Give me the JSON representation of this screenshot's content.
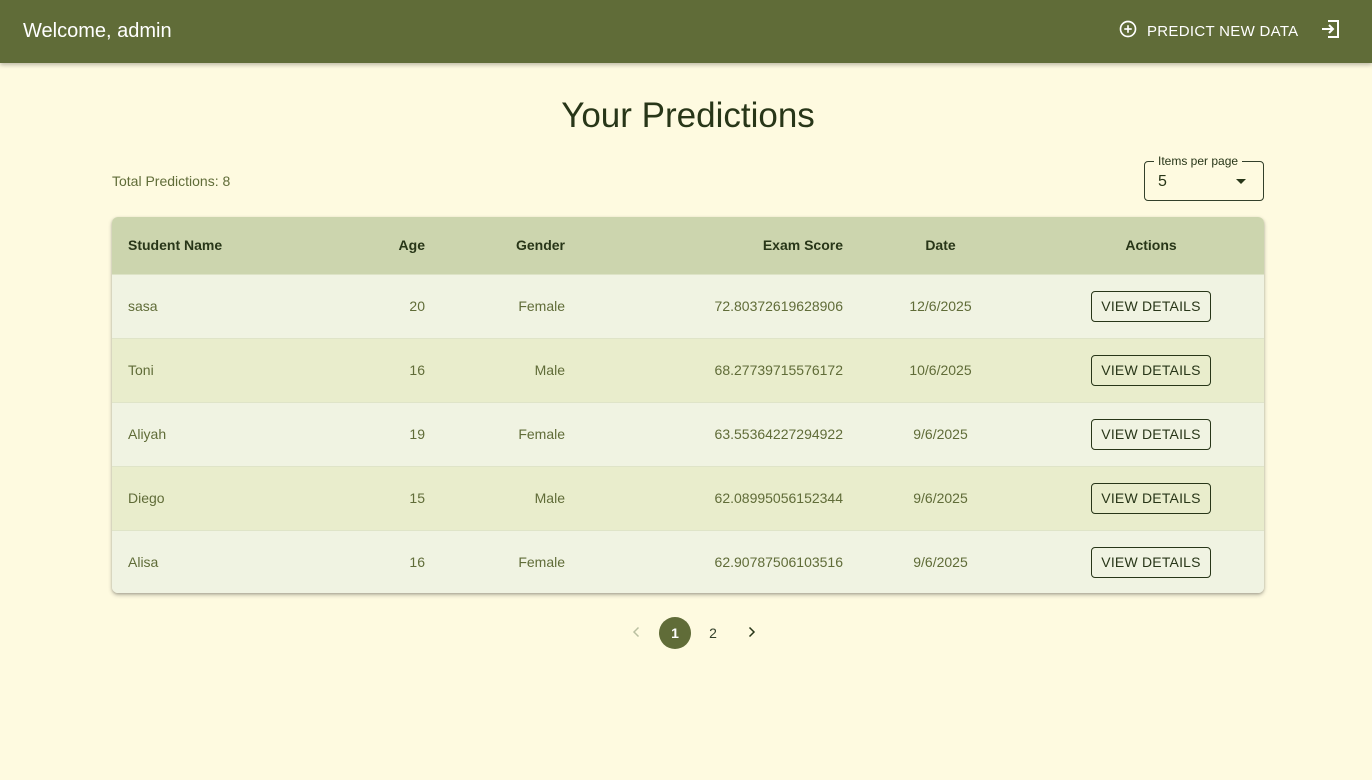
{
  "header": {
    "welcome": "Welcome, admin",
    "predict_label": "PREDICT NEW DATA",
    "predict_icon": "add-circle-icon",
    "logout_icon": "logout-icon"
  },
  "main": {
    "title": "Your Predictions",
    "total": "Total Predictions: 8",
    "items_per_page": {
      "label": "Items per page",
      "value": "5"
    }
  },
  "table": {
    "columns": [
      "Student Name",
      "Age",
      "Gender",
      "Exam Score",
      "Date",
      "Actions"
    ],
    "rows": [
      {
        "name": "sasa",
        "age": "20",
        "gender": "Female",
        "score": "72.80372619628906",
        "date": "12/6/2025",
        "action": "VIEW DETAILS"
      },
      {
        "name": "Toni",
        "age": "16",
        "gender": "Male",
        "score": "68.27739715576172",
        "date": "10/6/2025",
        "action": "VIEW DETAILS"
      },
      {
        "name": "Aliyah",
        "age": "19",
        "gender": "Female",
        "score": "63.55364227294922",
        "date": "9/6/2025",
        "action": "VIEW DETAILS"
      },
      {
        "name": "Diego",
        "age": "15",
        "gender": "Male",
        "score": "62.08995056152344",
        "date": "9/6/2025",
        "action": "VIEW DETAILS"
      },
      {
        "name": "Alisa",
        "age": "16",
        "gender": "Female",
        "score": "62.90787506103516",
        "date": "9/6/2025",
        "action": "VIEW DETAILS"
      }
    ]
  },
  "pagination": {
    "pages": [
      "1",
      "2"
    ],
    "current": "1"
  },
  "colors": {
    "appbar": "#606c38",
    "background": "#fefae0",
    "table_header": "#ccd5ae",
    "text_dark": "#283618"
  }
}
